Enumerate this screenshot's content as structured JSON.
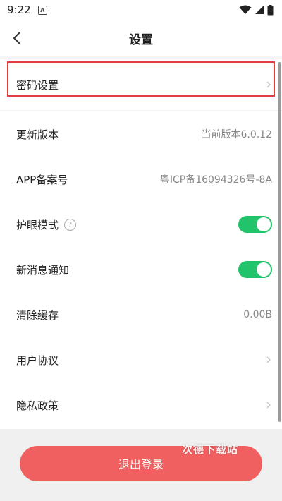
{
  "status_bar": {
    "time": "9:22",
    "app_icon": "A",
    "icons": [
      "wifi-icon",
      "signal-icon",
      "battery-icon"
    ]
  },
  "header": {
    "title": "设置",
    "back_icon": "chevron-left-icon"
  },
  "password_settings": {
    "label": "密码设置"
  },
  "settings": {
    "update": {
      "label": "更新版本",
      "value": "当前版本6.0.12"
    },
    "icp": {
      "label": "APP备案号",
      "value": "粤ICP备16094326号-8A"
    },
    "eye_care": {
      "label": "护眼模式",
      "help": "?",
      "enabled": true
    },
    "notifications": {
      "label": "新消息通知",
      "enabled": true
    },
    "cache": {
      "label": "清除缓存",
      "value": "0.00B"
    },
    "user_agreement": {
      "label": "用户协议"
    },
    "privacy": {
      "label": "隐私政策"
    }
  },
  "logout": {
    "label": "退出登录"
  },
  "watermark": "次德下载站",
  "colors": {
    "accent": "#f06060",
    "toggle_on": "#21c46a",
    "highlight": "#e53b3b"
  }
}
